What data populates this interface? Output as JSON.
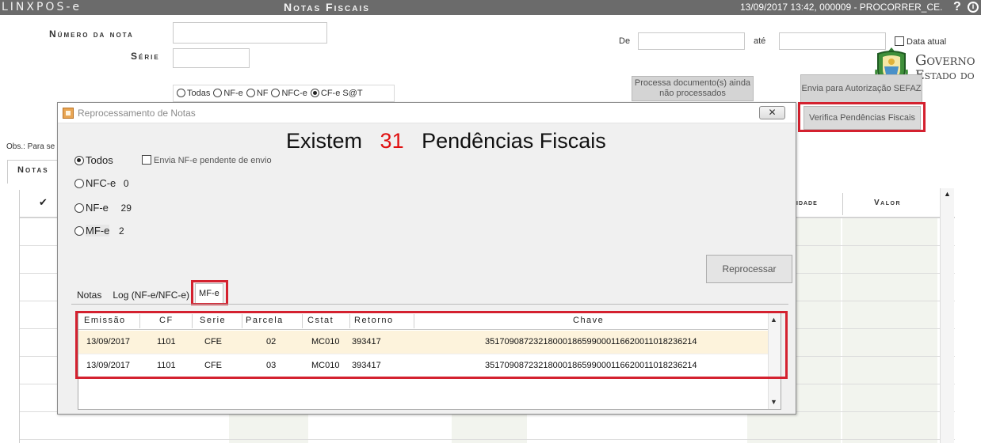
{
  "app": {
    "logo": "LINXPOS-e",
    "title": "Notas Fiscais",
    "status": "13/09/2017 13:42, 000009 - PROCORRER_CE.",
    "help_glyph": "?",
    "info_glyph": "i"
  },
  "filters": {
    "numero_label": "Número da nota",
    "serie_label": "Série",
    "de_label": "De",
    "ate_label": "até",
    "data_atual_label": "Data atual",
    "radios": [
      {
        "label": "Todas",
        "checked": false
      },
      {
        "label": "NF-e",
        "checked": false
      },
      {
        "label": "NF",
        "checked": false
      },
      {
        "label": "NFC-e",
        "checked": false
      },
      {
        "label": "CF-e S@T",
        "checked": true
      }
    ]
  },
  "gov_logo": {
    "line1": "Governo",
    "line2": "Estado do"
  },
  "buttons": {
    "processa": "Processa documento(s) ainda não processados",
    "envia": "Envia para Autorização SEFAZ",
    "verifica": "Verifica Pendências Fiscais"
  },
  "background": {
    "obs": "Obs.: Para se",
    "notas_tab": "Notas",
    "col_quantidade": "idade",
    "col_valor": "Valor",
    "check_glyph": "✔"
  },
  "modal": {
    "title": "Reprocessamento de Notas",
    "close_glyph": "✕",
    "headline_prefix": "Existem",
    "count": "31",
    "headline_suffix": "Pendências Fiscais",
    "options": [
      {
        "label": "Todos",
        "count": "",
        "checked": true
      },
      {
        "label": "NFC-e",
        "count": "0",
        "checked": false
      },
      {
        "label": "NF-e",
        "count": "29",
        "checked": false
      },
      {
        "label": "MF-e",
        "count": "2",
        "checked": false
      }
    ],
    "envia_pendente_label": "Envia NF-e pendente de envio",
    "reprocessar_label": "Reprocessar",
    "tabs": [
      {
        "label": "Notas",
        "active": false
      },
      {
        "label": "Log (NF-e/NFC-e)",
        "active": false
      },
      {
        "label": "MF-e",
        "active": true
      }
    ],
    "grid": {
      "columns": [
        "Emissão",
        "CF",
        "Serie",
        "Parcela",
        "Cstat",
        "Retorno",
        "Chave"
      ],
      "rows": [
        {
          "emissao": "13/09/2017",
          "cf": "1101",
          "serie": "CFE",
          "parcela": "02",
          "cstat": "MC010",
          "retorno": "393417",
          "chave": "35170908723218000186599000116620011018236214"
        },
        {
          "emissao": "13/09/2017",
          "cf": "1101",
          "serie": "CFE",
          "parcela": "03",
          "cstat": "MC010",
          "retorno": "393417",
          "chave": "35170908723218000186599000116620011018236214"
        }
      ]
    }
  },
  "colors": {
    "highlight": "#d4212f",
    "count": "#e01010",
    "titlebar": "#6b6b6b",
    "selected_row": "#fdf3dc"
  }
}
